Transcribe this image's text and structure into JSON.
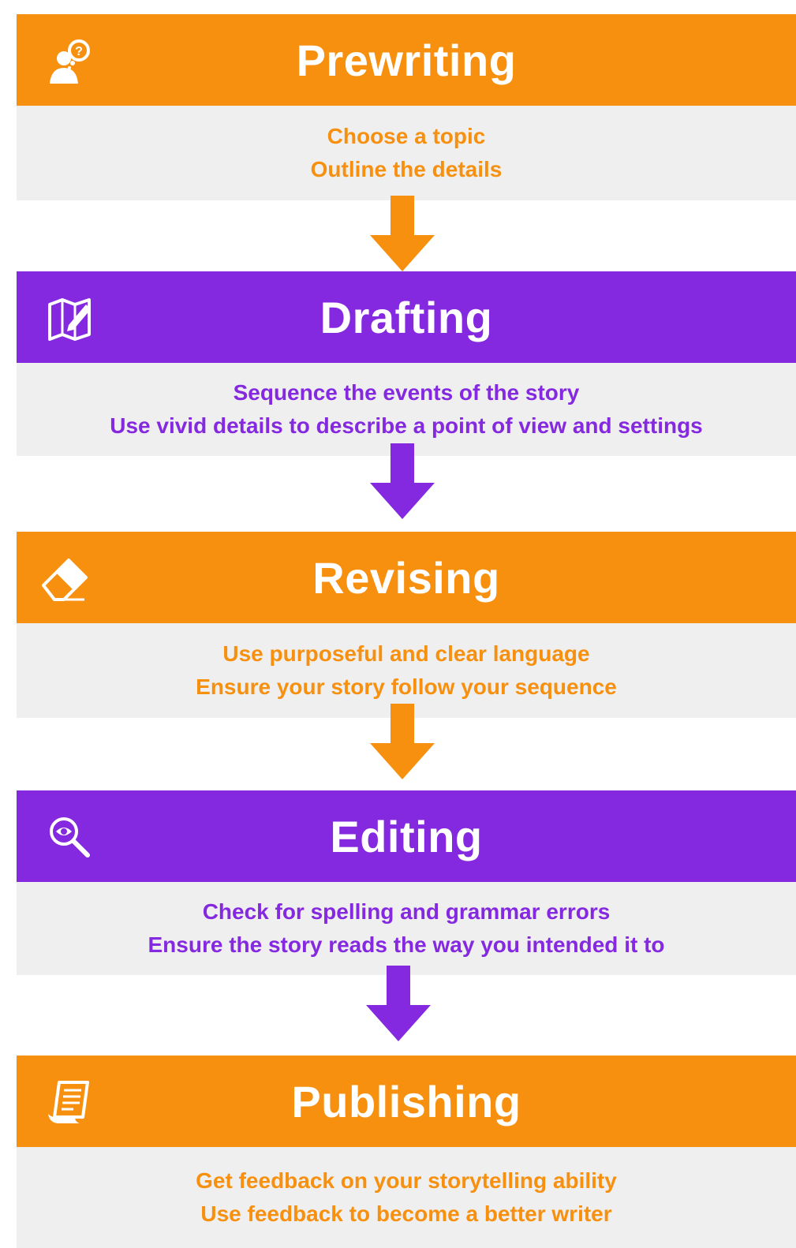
{
  "colors": {
    "orange": "#f7900f",
    "purple": "#8429e0",
    "panel": "#efefef"
  },
  "steps": [
    {
      "title": "Prewriting",
      "icon": "thinking-person-icon",
      "lines": [
        "Choose a topic",
        "Outline the details"
      ]
    },
    {
      "title": "Drafting",
      "icon": "map-pencil-icon",
      "lines": [
        "Sequence the events of the story",
        "Use vivid details to describe a point of view and settings"
      ]
    },
    {
      "title": "Revising",
      "icon": "eraser-icon",
      "lines": [
        "Use purposeful and clear language",
        "Ensure your story follow your sequence"
      ]
    },
    {
      "title": "Editing",
      "icon": "magnifier-eye-icon",
      "lines": [
        "Check for spelling and grammar errors",
        "Ensure the story reads the way you intended it to"
      ]
    },
    {
      "title": "Publishing",
      "icon": "document-scroll-icon",
      "lines": [
        "Get feedback on your storytelling ability",
        "Use feedback to become a better writer"
      ]
    }
  ]
}
